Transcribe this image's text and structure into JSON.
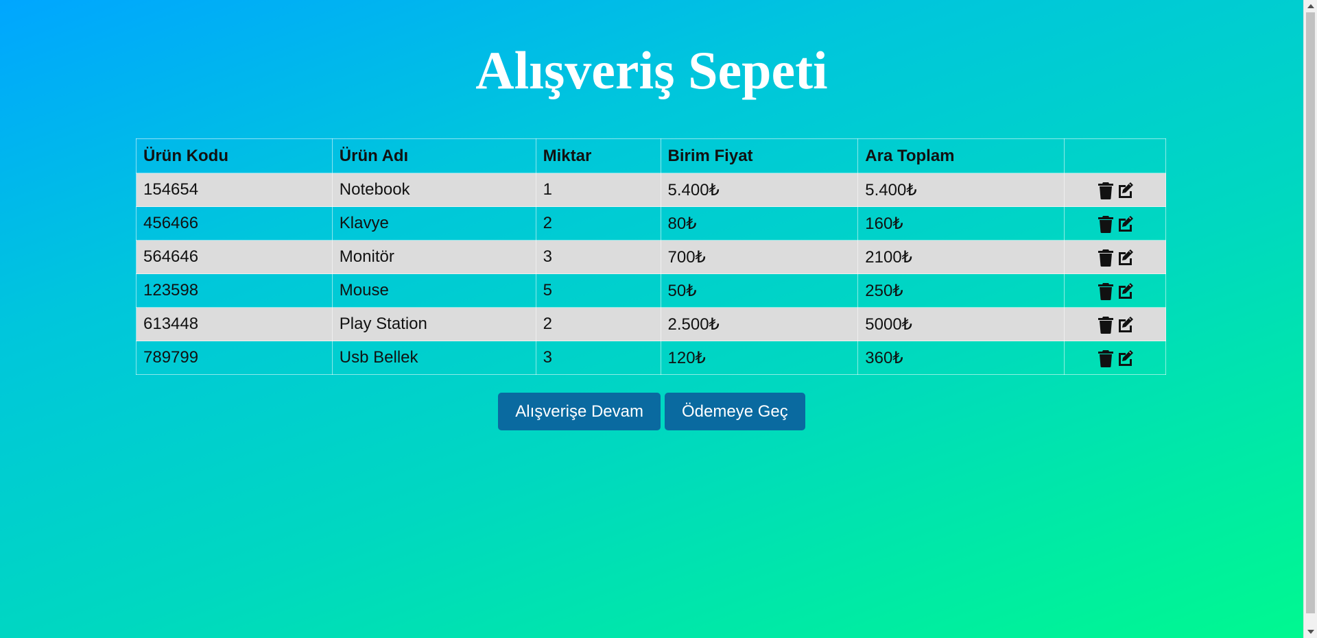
{
  "page": {
    "title": "Alışveriş Sepeti"
  },
  "table": {
    "headers": [
      "Ürün Kodu",
      "Ürün Adı",
      "Miktar",
      "Birim Fiyat",
      "Ara Toplam",
      ""
    ],
    "rows": [
      {
        "code": "154654",
        "name": "Notebook",
        "qty": "1",
        "unit_price": "5.400₺",
        "subtotal": "5.400₺"
      },
      {
        "code": "456466",
        "name": "Klavye",
        "qty": "2",
        "unit_price": "80₺",
        "subtotal": "160₺"
      },
      {
        "code": "564646",
        "name": "Monitör",
        "qty": "3",
        "unit_price": "700₺",
        "subtotal": "2100₺"
      },
      {
        "code": "123598",
        "name": "Mouse",
        "qty": "5",
        "unit_price": "50₺",
        "subtotal": "250₺"
      },
      {
        "code": "613448",
        "name": "Play Station",
        "qty": "2",
        "unit_price": "2.500₺",
        "subtotal": "5000₺"
      },
      {
        "code": "789799",
        "name": "Usb Bellek",
        "qty": "3",
        "unit_price": "120₺",
        "subtotal": "360₺"
      }
    ],
    "row_icons": [
      "trash-icon",
      "edit-icon"
    ]
  },
  "buttons": {
    "continue_label": "Alışverişe Devam",
    "checkout_label": "Ödemeye Geç"
  },
  "colors": {
    "gradient_start": "#00a6ff",
    "gradient_end": "#00f890",
    "button_bg": "#0a6aa0",
    "stripe_row": "#dcdcdc"
  }
}
